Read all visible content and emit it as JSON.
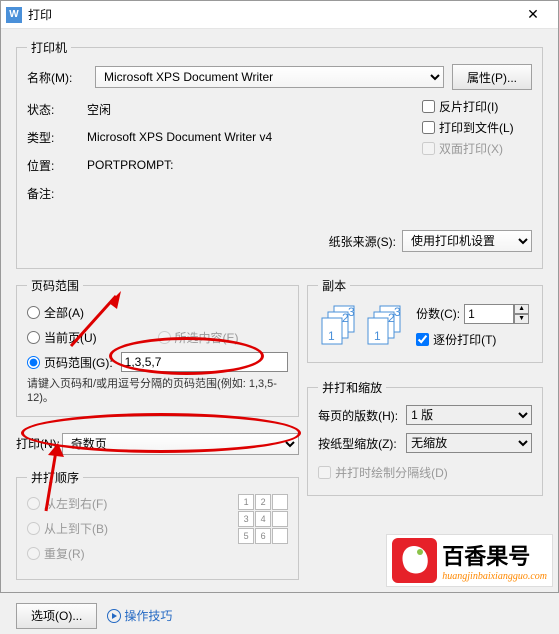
{
  "titlebar": {
    "title": "打印",
    "icon_letter": "W"
  },
  "printer": {
    "legend": "打印机",
    "name_label": "名称(M):",
    "name_value": "Microsoft XPS Document Writer",
    "properties_btn": "属性(P)...",
    "status_label": "状态:",
    "status_value": "空闲",
    "type_label": "类型:",
    "type_value": "Microsoft XPS Document Writer v4",
    "where_label": "位置:",
    "where_value": "PORTPROMPT:",
    "comment_label": "备注:",
    "mirror_cb": "反片打印(I)",
    "tofile_cb": "打印到文件(L)",
    "duplex_cb": "双面打印(X)",
    "paper_source_label": "纸张来源(S):",
    "paper_source_value": "使用打印机设置"
  },
  "range": {
    "legend": "页码范围",
    "all": "全部(A)",
    "current": "当前页(U)",
    "selected": "所选内容(E)",
    "pages": "页码范围(G):",
    "pages_value": "1,3,5,7",
    "hint": "请键入页码和/或用逗号分隔的页码范围(例如: 1,3,5-12)。"
  },
  "copies": {
    "legend": "副本",
    "count_label": "份数(C):",
    "count_value": "1",
    "collate": "逐份打印(T)"
  },
  "print": {
    "label": "打印(N):",
    "value": "奇数页",
    "order_legend": "并打顺序",
    "ltr": "从左到右(F)",
    "ttb": "从上到下(B)",
    "repeat": "重复(R)"
  },
  "scale": {
    "legend": "并打和缩放",
    "per_page_label": "每页的版数(H):",
    "per_page_value": "1 版",
    "scale_label": "按纸型缩放(Z):",
    "scale_value": "无缩放",
    "drawline_cb": "并打时绘制分隔线(D)"
  },
  "bottom": {
    "options": "选项(O)...",
    "tips": "操作技巧"
  },
  "watermark": {
    "text": "百香果号",
    "sub": "huangjinbaixiangguo.com"
  }
}
